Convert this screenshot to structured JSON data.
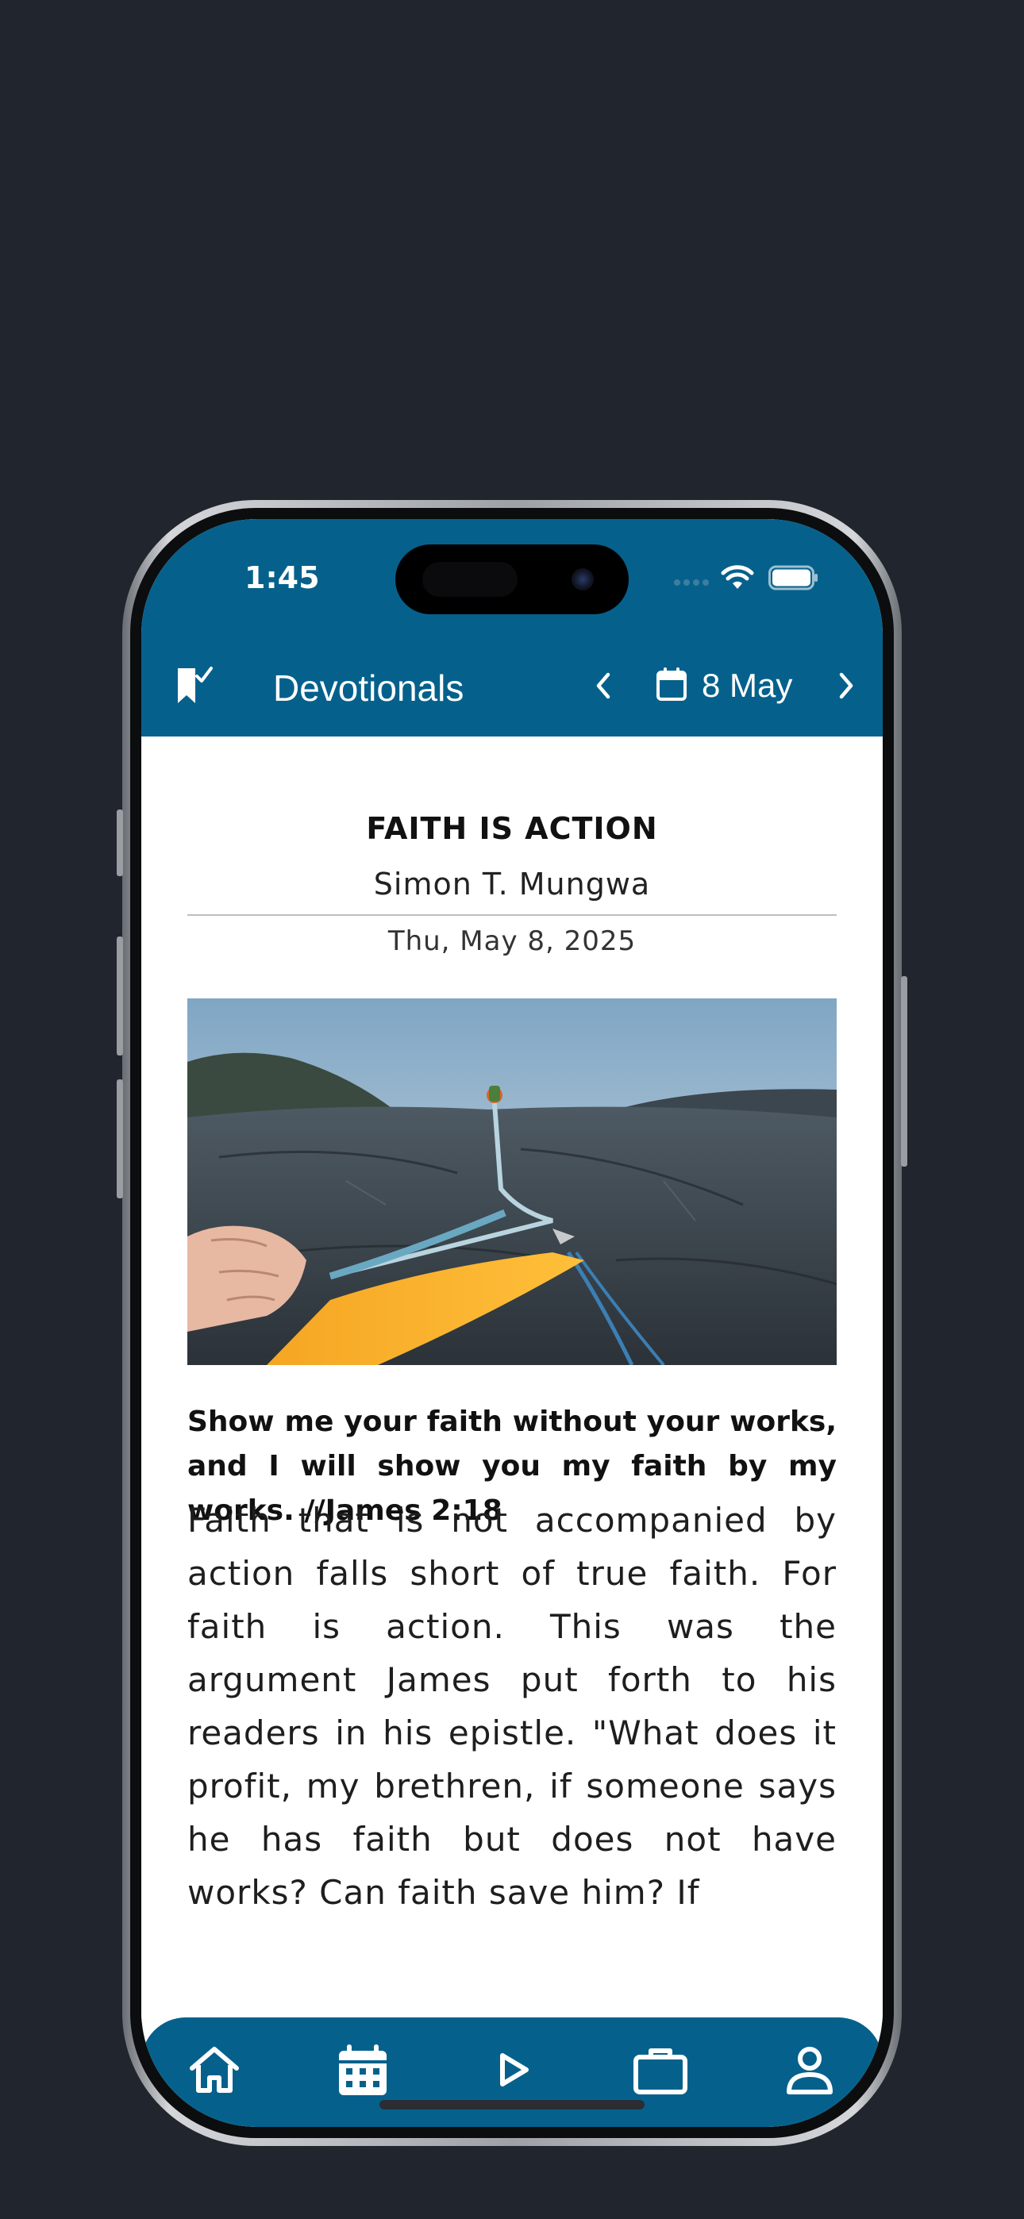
{
  "status_bar": {
    "time": "1:45",
    "icons": [
      "signal-icon",
      "wifi-icon",
      "battery-icon"
    ]
  },
  "header": {
    "title": "Devotionals",
    "date": "8 May",
    "icons": [
      "bookmark-icon",
      "chevron-left-icon",
      "calendar-icon",
      "chevron-right-icon"
    ]
  },
  "article": {
    "title": "FAITH IS ACTION",
    "author": "Simon T. Mungwa",
    "date": "Thu, May 8, 2025",
    "image_subject": "climbing-rope-photo",
    "memory_verse": "Show me your faith without your works, and I will show you my faith by my works. //James 2:18",
    "body": "Faith that is not accompanied by action falls short of true faith. For faith is action. This was the argument James put forth to his readers in his epistle. \"What does it profit, my brethren, if someone says he has faith but does not have works? Can faith save him? If"
  },
  "bottom_nav": {
    "items": [
      "home-icon",
      "calendar-icon",
      "play-icon",
      "briefcase-icon",
      "profile-icon"
    ]
  },
  "colors": {
    "brand": "#05618c",
    "page_background": "#21252d",
    "content_background": "#ffffff",
    "text": "#111111"
  }
}
